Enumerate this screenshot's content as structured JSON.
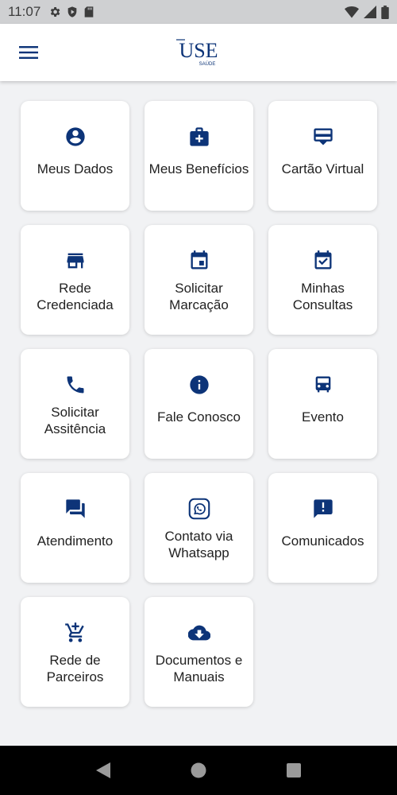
{
  "status_bar": {
    "time": "11:07",
    "left_icons": [
      "gear-icon",
      "play-protect-icon",
      "sd-card-icon"
    ],
    "right_icons": [
      "wifi-icon",
      "signal-icon",
      "battery-icon"
    ]
  },
  "header": {
    "logo_text": "USE",
    "logo_subtext": "SAÚDE",
    "menu_icon": "hamburger-menu-icon"
  },
  "colors": {
    "accent": "#0d3478",
    "background": "#f1f2f4",
    "card": "#ffffff",
    "text": "#222222"
  },
  "tiles": [
    {
      "label": "Meus Dados",
      "icon": "account-circle-icon"
    },
    {
      "label": "Meus Benefícios",
      "icon": "medical-bag-icon"
    },
    {
      "label": "Cartão Virtual",
      "icon": "card-icon"
    },
    {
      "label": "Rede Credenciada",
      "icon": "store-icon"
    },
    {
      "label": "Solicitar Marcação",
      "icon": "calendar-icon"
    },
    {
      "label": "Minhas Consultas",
      "icon": "calendar-check-icon"
    },
    {
      "label": "Solicitar Assitência",
      "icon": "phone-icon"
    },
    {
      "label": "Fale Conosco",
      "icon": "info-icon"
    },
    {
      "label": "Evento",
      "icon": "car-icon"
    },
    {
      "label": "Atendimento",
      "icon": "chat-icon"
    },
    {
      "label": "Contato via Whatsapp",
      "icon": "whatsapp-icon"
    },
    {
      "label": "Comunicados",
      "icon": "announcement-icon"
    },
    {
      "label": "Rede de Parceiros",
      "icon": "add-cart-icon"
    },
    {
      "label": "Documentos e Manuais",
      "icon": "cloud-download-icon"
    }
  ],
  "nav_bar": {
    "buttons": [
      "back-icon",
      "home-icon",
      "recents-icon"
    ]
  }
}
